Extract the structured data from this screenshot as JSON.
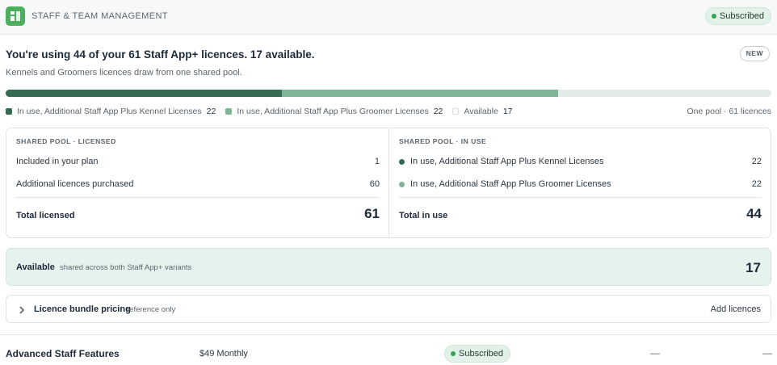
{
  "header": {
    "title": "STAFF & TEAM MANAGEMENT",
    "status": "Subscribed",
    "logo_icon": "staff-app-icon",
    "accent": "#4caf5f"
  },
  "summary": {
    "headline": "You're using 44 of your 61 Staff App+ licences. 17 available.",
    "badge": "NEW",
    "subline": "Kennels and Groomers licences draw from one shared pool."
  },
  "usage_bar": {
    "segments": [
      {
        "name": "kennel",
        "value": 22,
        "color": "#356b4f"
      },
      {
        "name": "groomer",
        "value": 22,
        "color": "#7fb597"
      },
      {
        "name": "available",
        "value": 17,
        "color": "#e2ece6"
      }
    ],
    "total": 61
  },
  "legend": {
    "kennel_label": "In use, Additional Staff App Plus Kennel Licenses",
    "kennel_value": "22",
    "groomer_label": "In use, Additional Staff App Plus Groomer Licenses",
    "groomer_value": "22",
    "available_label": "Available",
    "available_value": "17",
    "pool_note": "One pool · 61 licences"
  },
  "licensed": {
    "kicker": "SHARED POOL · LICENSED",
    "rows": [
      {
        "label": "Included in your plan",
        "value": "1"
      },
      {
        "label": "Additional licences purchased",
        "value": "60"
      }
    ],
    "total_label": "Total licensed",
    "total_value": "61"
  },
  "in_use": {
    "kicker": "SHARED POOL · IN USE",
    "rows": [
      {
        "label": "In use, Additional Staff App Plus Kennel Licenses",
        "value": "22",
        "color": "#356b4f"
      },
      {
        "label": "In use, Additional Staff App Plus Groomer Licenses",
        "value": "22",
        "color": "#7fb597"
      }
    ],
    "total_label": "Total in use",
    "total_value": "44"
  },
  "available": {
    "label": "Available",
    "note": "shared across both Staff App+ variants",
    "value": "17"
  },
  "bundle": {
    "label": "Licence bundle pricing",
    "note": "reference only",
    "action": "Add licences"
  },
  "feature": {
    "name": "Advanced Staff Features",
    "price": "$49 Monthly",
    "status": "Subscribed",
    "col_a": "—",
    "col_b": "—"
  }
}
